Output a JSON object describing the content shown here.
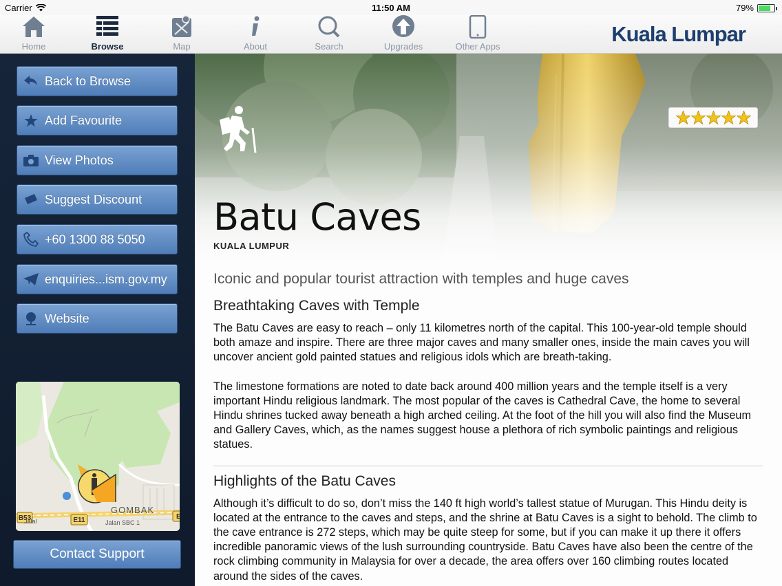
{
  "status": {
    "carrier": "Carrier",
    "time": "11:50 AM",
    "battery": "79%",
    "battery_level": 0.79
  },
  "toolbar": {
    "tabs": [
      {
        "label": "Home",
        "icon": "house-icon"
      },
      {
        "label": "Browse",
        "icon": "list-icon",
        "active": true
      },
      {
        "label": "Map",
        "icon": "map-icon"
      },
      {
        "label": "About",
        "icon": "info-icon"
      },
      {
        "label": "Search",
        "icon": "magnifier-icon"
      },
      {
        "label": "Upgrades",
        "icon": "upload-arrow-icon"
      },
      {
        "label": "Other Apps",
        "icon": "tablet-icon"
      }
    ],
    "brand": "Kuala Lumpar"
  },
  "sidebar": {
    "buttons": [
      {
        "label": "Back to Browse",
        "icon": "back-arrow-icon"
      },
      {
        "label": "Add Favourite",
        "icon": "star-icon"
      },
      {
        "label": "View Photos",
        "icon": "camera-icon"
      },
      {
        "label": "Suggest Discount",
        "icon": "ticket-icon"
      },
      {
        "label": "+60 1300 88 5050",
        "icon": "phone-icon"
      },
      {
        "label": "enquiries...ism.gov.my",
        "icon": "paper-plane-icon"
      },
      {
        "label": "Website",
        "icon": "globe-icon"
      }
    ],
    "map": {
      "labels": [
        "GOMBAK",
        "B53",
        "E11",
        "E",
        "Jalan SBC 1",
        "Jalal"
      ]
    },
    "contact_label": "Contact Support"
  },
  "main": {
    "title": "Batu Caves",
    "subtitle": "KUALA LUMPUR",
    "rating": 5,
    "tagline": "Iconic and popular tourist attraction with temples and huge caves",
    "sections": [
      {
        "heading": "Breathtaking Caves with Temple",
        "paragraphs": [
          "The Batu Caves are easy to reach – only 11 kilometres north of the capital. This 100-year-old temple should both amaze and inspire. There are three major caves and many smaller ones, inside the main caves you will uncover ancient gold painted statues and religious idols which are breath-taking.",
          "The limestone formations are noted to date back around 400 million years and the temple itself is a very important Hindu religious landmark. The most popular of the caves is Cathedral Cave, the home to several Hindu shrines tucked away beneath a high arched ceiling. At the foot of the hill you will also find the Museum and Gallery Caves, which, as the names suggest house a plethora of rich symbolic paintings and religious statues."
        ]
      },
      {
        "heading": "Highlights of the Batu Caves",
        "paragraphs": [
          "Although it’s difficult to do so, don’t miss the 140 ft high world’s tallest statue of Murugan. This Hindu deity is located at the entrance to the caves and steps, and the shrine at Batu Caves is a sight to behold. The climb to the cave entrance is 272 steps, which may be quite steep for some, but if you can make it up there it offers incredible panoramic views of the lush surrounding countryside. Batu Caves have also been the centre of the rock climbing community in Malaysia for over a decade, the area offers over 160 climbing routes located around the sides of the caves."
        ]
      }
    ]
  }
}
